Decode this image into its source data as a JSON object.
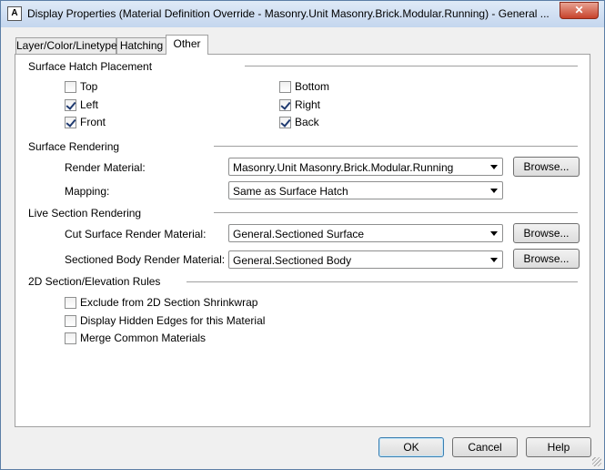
{
  "window": {
    "title": "Display Properties (Material Definition Override - Masonry.Unit Masonry.Brick.Modular.Running) - General ...",
    "close_glyph": "✕",
    "app_icon_letter": "A"
  },
  "tabs": [
    {
      "label": "Layer/Color/Linetype",
      "active": false
    },
    {
      "label": "Hatching",
      "active": false
    },
    {
      "label": "Other",
      "active": true
    }
  ],
  "surface_hatch": {
    "title": "Surface Hatch Placement",
    "top": {
      "label": "Top",
      "checked": false
    },
    "bottom": {
      "label": "Bottom",
      "checked": false
    },
    "left": {
      "label": "Left",
      "checked": true
    },
    "right": {
      "label": "Right",
      "checked": true
    },
    "front": {
      "label": "Front",
      "checked": true
    },
    "back": {
      "label": "Back",
      "checked": true
    }
  },
  "surface_rendering": {
    "title": "Surface Rendering",
    "render_material_label": "Render Material:",
    "render_material_value": "Masonry.Unit Masonry.Brick.Modular.Running",
    "mapping_label": "Mapping:",
    "mapping_value": "Same as Surface Hatch",
    "browse_label": "Browse..."
  },
  "live_section": {
    "title": "Live Section Rendering",
    "cut_label": "Cut Surface Render Material:",
    "cut_value": "General.Sectioned Surface",
    "body_label": "Sectioned Body Render Material:",
    "body_value": "General.Sectioned Body",
    "browse_label": "Browse..."
  },
  "section_rules": {
    "title": "2D Section/Elevation Rules",
    "exclude": {
      "label": "Exclude from 2D Section Shrinkwrap",
      "checked": false
    },
    "hidden": {
      "label": "Display Hidden Edges for this Material",
      "checked": false
    },
    "merge": {
      "label": "Merge Common Materials",
      "checked": false
    }
  },
  "footer": {
    "ok": "OK",
    "cancel": "Cancel",
    "help": "Help"
  }
}
